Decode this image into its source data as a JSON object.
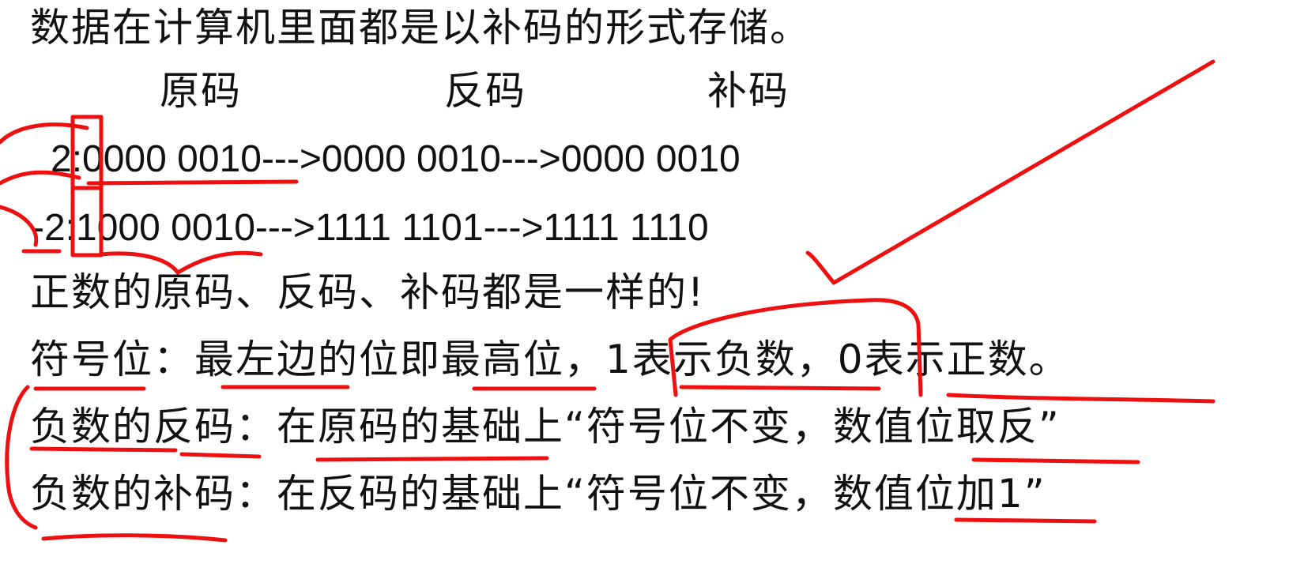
{
  "document": {
    "intro": "数据在计算机里面都是以补码的形式存储。",
    "headers": {
      "original": "原码",
      "ones_complement": "反码",
      "twos_complement": "补码"
    },
    "rows": [
      {
        "label": "2:",
        "original": "0000 0010",
        "ones": "0000 0010",
        "twos": "0000 0010"
      },
      {
        "label": "-2:",
        "original": "1000 0010",
        "ones": "1111 1101",
        "twos": "1111 1110"
      }
    ],
    "arrow": "--->",
    "lines": [
      "正数的原码、反码、补码都是一样的!",
      "符号位：最左边的位即最高位，1表示负数，0表示正数。",
      "负数的反码：在原码的基础上“符号位不变，数值位取反”",
      "负数的补码：在反码的基础上“符号位不变，数值位加1”"
    ]
  },
  "annotation_color": "#ee1010",
  "text_color": "#111111"
}
